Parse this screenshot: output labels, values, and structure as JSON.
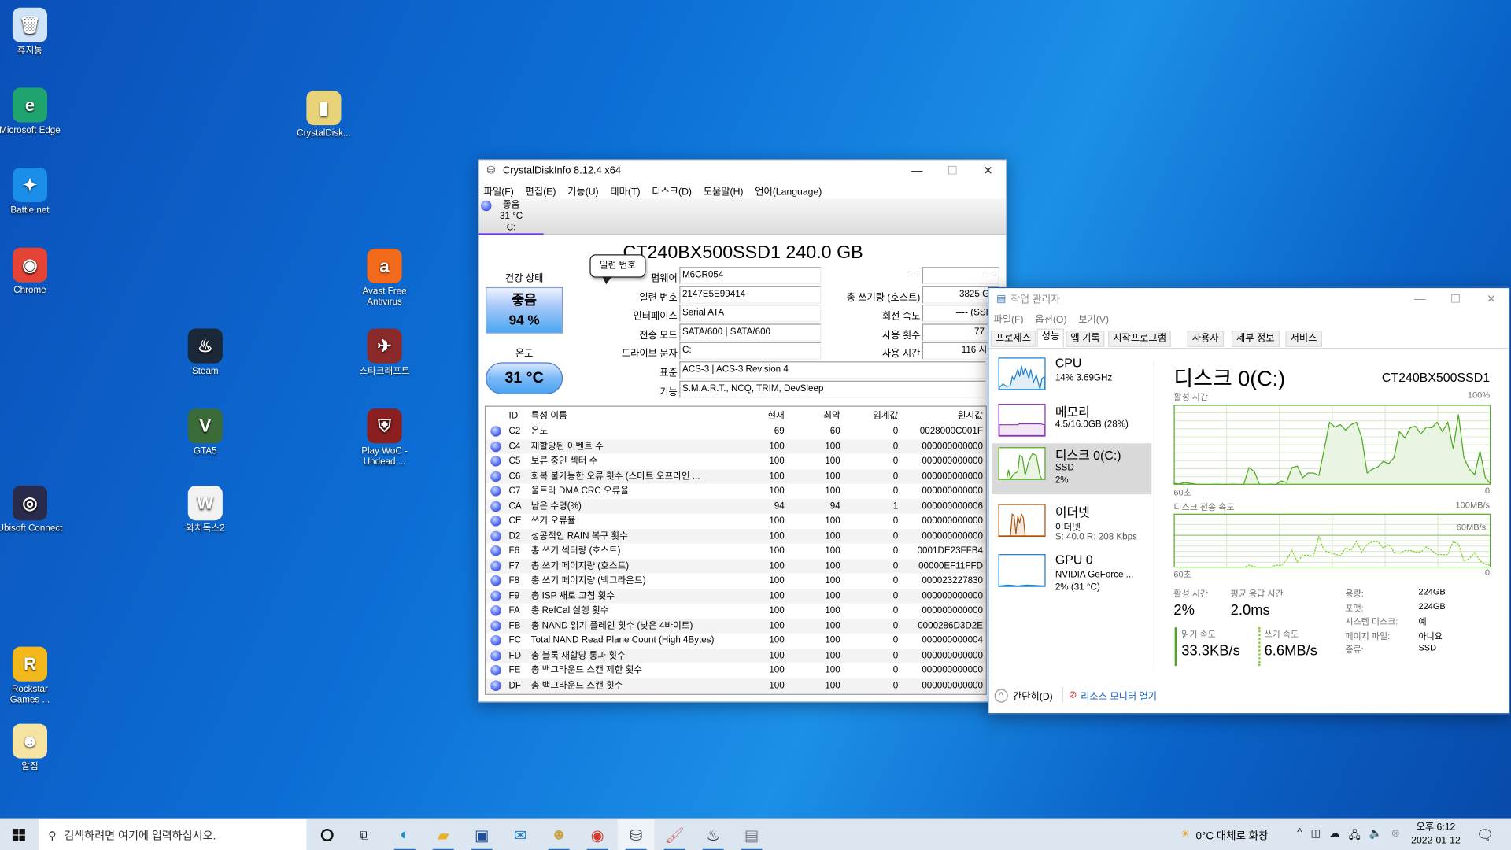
{
  "desktop": {
    "icons": [
      {
        "label": "휴지통",
        "glyph": "🗑",
        "color": "#cfe4f7"
      },
      {
        "label": "Microsoft Edge",
        "glyph": "e",
        "color": "#1fa36f"
      },
      {
        "label": "Battle.net",
        "glyph": "✦",
        "color": "#1a8ee8"
      },
      {
        "label": "Chrome",
        "glyph": "◉",
        "color": "#e54335"
      },
      {
        "label": "Ubisoft Connect",
        "glyph": "◎",
        "color": "#2a2a4a"
      },
      {
        "label": "Rockstar Games ...",
        "glyph": "R",
        "color": "#f3b81b"
      },
      {
        "label": "알집",
        "glyph": "☻",
        "color": "#f4e3a1"
      },
      {
        "label": "Steam",
        "glyph": "♨",
        "color": "#1b2838"
      },
      {
        "label": "GTA5",
        "glyph": "V",
        "color": "#3c6b3a"
      },
      {
        "label": "와치독스2",
        "glyph": "W",
        "color": "#f2f2f2"
      },
      {
        "label": "CrystalDisk...",
        "glyph": "▮",
        "color": "#e8d27a"
      },
      {
        "label": "Avast Free Antivirus",
        "glyph": "a",
        "color": "#f26a1b"
      },
      {
        "label": "스타크래프트",
        "glyph": "✈",
        "color": "#8a2a2a"
      },
      {
        "label": "Play WoC - Undead ...",
        "glyph": "⛨",
        "color": "#8b1e1e"
      }
    ]
  },
  "cdi": {
    "title": "CrystalDiskInfo 8.12.4 x64",
    "menu": [
      "파일(F)",
      "편집(E)",
      "기능(U)",
      "테마(T)",
      "디스크(D)",
      "도움말(H)",
      "언어(Language)"
    ],
    "drive_tab": {
      "status": "좋음",
      "temp": "31 °C",
      "letter": "C:"
    },
    "model": "CT240BX500SSD1 240.0 GB",
    "tooltip": "일련 번호",
    "health_label": "건강 상태",
    "health_status": "좋음",
    "health_percent": "94 %",
    "temp_label": "온도",
    "temp_value": "31 °C",
    "info_left": [
      {
        "label": "펌웨어",
        "value": "M6CR054"
      },
      {
        "label": "일련 번호",
        "value": "2147E5E99414"
      },
      {
        "label": "인터페이스",
        "value": "Serial ATA"
      },
      {
        "label": "전송 모드",
        "value": "SATA/600 | SATA/600"
      },
      {
        "label": "드라이브 문자",
        "value": "C:"
      }
    ],
    "info_right": [
      {
        "label": "----",
        "value": "----"
      },
      {
        "label": "총 쓰기량 (호스트)",
        "value": "3825 GB"
      },
      {
        "label": "회전 속도",
        "value": "---- (SSD)"
      },
      {
        "label": "사용 횟수",
        "value": "77 회"
      },
      {
        "label": "사용 시간",
        "value": "116 시간"
      }
    ],
    "standard_label": "표준",
    "standard": "ACS-3 | ACS-3 Revision 4",
    "features_label": "기능",
    "features": "S.M.A.R.T., NCQ, TRIM, DevSleep",
    "smart_headers": [
      "ID",
      "특성 이름",
      "현재",
      "최악",
      "임계값",
      "원시값"
    ],
    "smart_rows": [
      [
        "C2",
        "온도",
        "69",
        "60",
        "0",
        "0028000C001F"
      ],
      [
        "C4",
        "재할당된 이벤트 수",
        "100",
        "100",
        "0",
        "000000000000"
      ],
      [
        "C5",
        "보류 중인 섹터 수",
        "100",
        "100",
        "0",
        "000000000000"
      ],
      [
        "C6",
        "회복 불가능한 오류 횟수 (스마트 오프라인 ...",
        "100",
        "100",
        "0",
        "000000000000"
      ],
      [
        "C7",
        "울트라 DMA CRC 오류율",
        "100",
        "100",
        "0",
        "000000000000"
      ],
      [
        "CA",
        "남은 수명(%)",
        "94",
        "94",
        "1",
        "000000000006"
      ],
      [
        "CE",
        "쓰기 오류율",
        "100",
        "100",
        "0",
        "000000000000"
      ],
      [
        "D2",
        "성공적인 RAIN 복구 횟수",
        "100",
        "100",
        "0",
        "000000000000"
      ],
      [
        "F6",
        "총 쓰기 섹터량 (호스트)",
        "100",
        "100",
        "0",
        "0001DE23FFB4"
      ],
      [
        "F7",
        "총 쓰기 페이지량 (호스트)",
        "100",
        "100",
        "0",
        "00000EF11FFD"
      ],
      [
        "F8",
        "총 쓰기 페이지량 (백그라운드)",
        "100",
        "100",
        "0",
        "000023227830"
      ],
      [
        "F9",
        "총 ISP 새로 고침 횟수",
        "100",
        "100",
        "0",
        "000000000000"
      ],
      [
        "FA",
        "총 RefCal 실행 횟수",
        "100",
        "100",
        "0",
        "000000000000"
      ],
      [
        "FB",
        "총 NAND 읽기 플레인 횟수 (낮은 4바이트)",
        "100",
        "100",
        "0",
        "0000286D3D2E"
      ],
      [
        "FC",
        "Total NAND Read Plane Count (High 4Bytes)",
        "100",
        "100",
        "0",
        "000000000004"
      ],
      [
        "FD",
        "총 블록 재할당 통과 횟수",
        "100",
        "100",
        "0",
        "000000000000"
      ],
      [
        "FE",
        "총 백그라운드 스캔 제한 횟수",
        "100",
        "100",
        "0",
        "000000000000"
      ],
      [
        "DF",
        "총 백그라운드 스캔 횟수",
        "100",
        "100",
        "0",
        "000000000000"
      ]
    ]
  },
  "tm": {
    "title": "작업 관리자",
    "menu": [
      "파일(F)",
      "옵션(O)",
      "보기(V)"
    ],
    "tabs": [
      "프로세스",
      "성능",
      "앱 기록",
      "시작프로그램",
      "사용자",
      "세부 정보",
      "서비스"
    ],
    "active_tab": "성능",
    "items": [
      {
        "name": "CPU",
        "l2": "14% 3.69GHz",
        "l3": "",
        "color": "#1c7ec9"
      },
      {
        "name": "메모리",
        "l2": "4.5/16.0GB (28%)",
        "l3": "",
        "color": "#8b2fb8"
      },
      {
        "name": "디스크 0(C:)",
        "l2": "SSD",
        "l3": "2%",
        "color": "#4ca71c"
      },
      {
        "name": "이더넷",
        "l2": "이더넷",
        "l3": "S: 40.0 R: 208 Kbps",
        "color": "#a7520d"
      },
      {
        "name": "GPU 0",
        "l2": "NVIDIA GeForce ...",
        "l3": "2% (31 °C)",
        "color": "#1c7ec9"
      }
    ],
    "detail": {
      "title": "디스크 0(C:)",
      "model": "CT240BX500SSD1",
      "graph1_label": "활성 시간",
      "graph1_max": "100%",
      "graph1_left": "60초",
      "graph1_right": "0",
      "graph2_label": "디스크 전송 속도",
      "graph2_max": "100MB/s",
      "graph2_mark": "60MB/s",
      "graph2_left": "60초",
      "graph2_right": "0",
      "active_time_label": "활성 시간",
      "active_time": "2%",
      "resp_label": "평균 응답 시간",
      "resp": "2.0ms",
      "read_label": "읽기 속도",
      "read": "33.3KB/s",
      "write_label": "쓰기 속도",
      "write": "6.6MB/s",
      "props": [
        [
          "용량:",
          "224GB"
        ],
        [
          "포맷:",
          "224GB"
        ],
        [
          "시스템 디스크:",
          "예"
        ],
        [
          "페이지 파일:",
          "아니요"
        ],
        [
          "종류:",
          "SSD"
        ]
      ],
      "active_history_percent": [
        2,
        1,
        3,
        2,
        1,
        0,
        0,
        0,
        1,
        0,
        0,
        1,
        0,
        0,
        22,
        17,
        0,
        0,
        1,
        0,
        5,
        3,
        22,
        24,
        9,
        15,
        15,
        12,
        45,
        80,
        74,
        77,
        70,
        77,
        80,
        60,
        15,
        20,
        23,
        30,
        27,
        35,
        68,
        60,
        73,
        75,
        65,
        74,
        73,
        80,
        68,
        80,
        46,
        90,
        35,
        20,
        13,
        43,
        9,
        1
      ],
      "write_history_mbps": [
        1,
        0,
        0,
        0,
        0,
        0,
        0,
        0,
        0,
        0,
        0,
        0,
        0,
        0,
        5,
        2,
        0,
        0,
        0,
        5,
        4,
        15,
        33,
        11,
        24,
        24,
        22,
        60,
        33,
        29,
        26,
        23,
        38,
        33,
        50,
        30,
        45,
        50,
        50,
        38,
        45,
        30,
        27,
        33,
        33,
        30,
        30,
        40,
        33,
        25,
        25,
        25,
        50,
        45,
        13,
        17,
        29,
        13,
        7,
        4
      ]
    },
    "fewer_details": "간단히(D)",
    "resmon": "리소스 모니터 열기"
  },
  "taskbar": {
    "search_placeholder": "검색하려면 여기에 입력하십시오.",
    "weather": "0°C  대체로 화창",
    "time": "오후 6:12",
    "date": "2022-01-12"
  },
  "colors": {
    "accent": "#1e6fd0",
    "disk_green": "#4ca71c",
    "cdi_good": "#5aa0f0"
  }
}
